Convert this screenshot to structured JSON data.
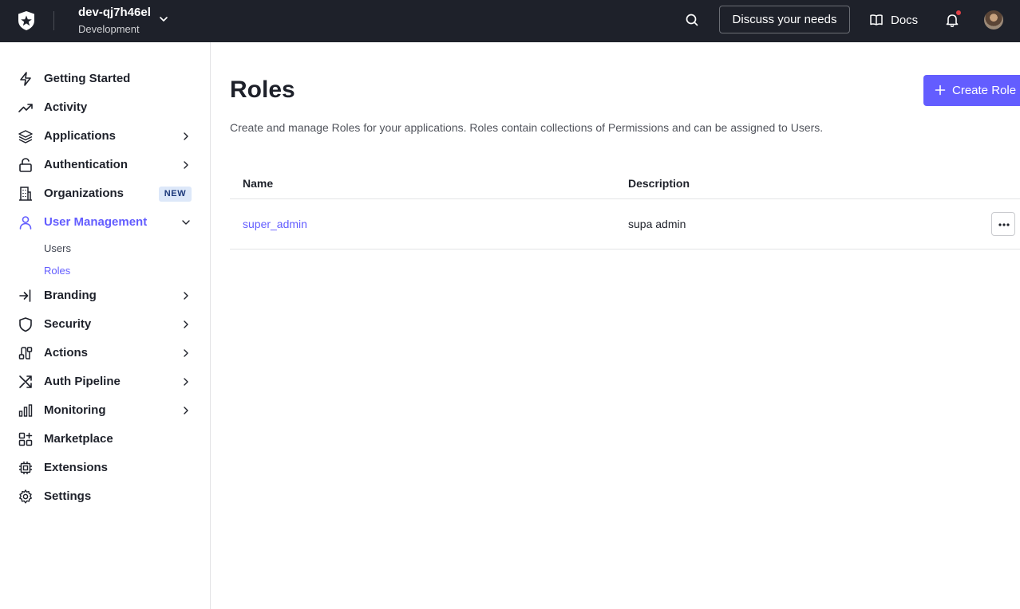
{
  "header": {
    "tenant_name": "dev-qj7h46el",
    "tenant_env": "Development",
    "discuss_label": "Discuss your needs",
    "docs_label": "Docs"
  },
  "sidebar": {
    "items": [
      {
        "label": "Getting Started",
        "icon": "bolt-icon"
      },
      {
        "label": "Activity",
        "icon": "trending-up-icon"
      },
      {
        "label": "Applications",
        "icon": "layers-icon"
      },
      {
        "label": "Authentication",
        "icon": "unlock-icon"
      },
      {
        "label": "Organizations",
        "icon": "building-icon",
        "badge": "NEW"
      },
      {
        "label": "User Management",
        "icon": "user-icon"
      },
      {
        "label": "Branding",
        "icon": "login-arrow-icon"
      },
      {
        "label": "Security",
        "icon": "shield-icon"
      },
      {
        "label": "Actions",
        "icon": "actions-flow-icon"
      },
      {
        "label": "Auth Pipeline",
        "icon": "shuffle-icon"
      },
      {
        "label": "Monitoring",
        "icon": "bar-chart-icon"
      },
      {
        "label": "Marketplace",
        "icon": "grid-plus-icon"
      },
      {
        "label": "Extensions",
        "icon": "chip-icon"
      },
      {
        "label": "Settings",
        "icon": "gear-icon"
      }
    ],
    "user_management_sub": [
      "Users",
      "Roles"
    ]
  },
  "main": {
    "title": "Roles",
    "create_label": "Create Role",
    "description": "Create and manage Roles for your applications. Roles contain collections of Permissions and can be assigned to Users.",
    "table": {
      "headers": [
        "Name",
        "Description"
      ],
      "rows": [
        {
          "name": "super_admin",
          "description": "supa admin"
        }
      ]
    }
  },
  "colors": {
    "accent": "#635dff",
    "topbar": "#1e212a",
    "notification_dot": "#e04046"
  }
}
